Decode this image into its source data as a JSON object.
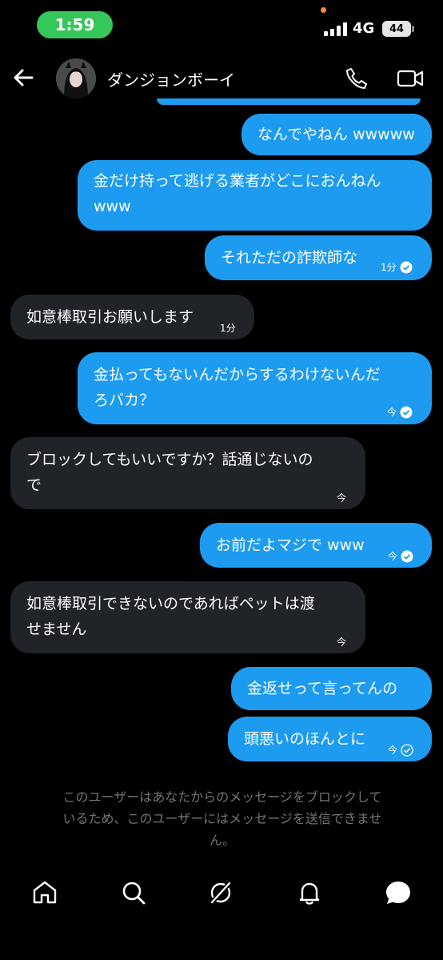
{
  "status_bar": {
    "time": "1:59",
    "network": "4G",
    "battery": "44"
  },
  "header": {
    "contact_name": "ダンジョンボーイ"
  },
  "messages": [
    {
      "dir": "out",
      "text": "なんでやねん wwwww",
      "time": "",
      "read": false
    },
    {
      "dir": "out",
      "text": "金だけ持って逃げる業者がどこにおんねん www",
      "time": "",
      "read": false
    },
    {
      "dir": "out",
      "text": "それただの詐欺師な",
      "time": "1分",
      "read": true
    },
    {
      "dir": "in",
      "text": "如意棒取引お願いします",
      "time": "1分"
    },
    {
      "dir": "out",
      "text": "金払ってもないんだからするわけないんだろバカ？",
      "time": "今",
      "read": true
    },
    {
      "dir": "in",
      "text": "ブロックしてもいいですか？話通じないので",
      "time": "今"
    },
    {
      "dir": "out",
      "text": "お前だよマジで www",
      "time": "今",
      "read": true
    },
    {
      "dir": "in",
      "text": "如意棒取引できないのであればペットは渡せません",
      "time": "今"
    },
    {
      "dir": "out",
      "text": "金返せって言ってんの",
      "time": "",
      "read": false
    },
    {
      "dir": "out",
      "text": "頭悪いのほんとに",
      "time": "今",
      "read": false
    }
  ],
  "message_lines": [
    [
      "なんでやねん wwwww"
    ],
    [
      "金だけ持って逃げる業者がどこにおんねん",
      "www"
    ],
    [
      "それただの詐欺師な"
    ],
    [
      "如意棒取引お願いします"
    ],
    [
      "金払ってもないんだからするわけないんだ",
      "ろバカ？"
    ],
    [
      "ブロックしてもいいですか？話通じないの",
      "で"
    ],
    [
      "お前だよマジで www"
    ],
    [
      "如意棒取引できないのであればペットは渡",
      "せません"
    ],
    [
      "金返せって言ってんの"
    ],
    [
      "頭悪いのほんとに"
    ]
  ],
  "notice": {
    "line1": "このユーザーはあなたからのメッセージをブロックして",
    "line2": "いるため、このユーザーにはメッセージを送信できませ",
    "line3": "ん。"
  },
  "nav": [
    "home-icon",
    "search-icon",
    "grok-icon",
    "notifications-icon",
    "messages-icon"
  ],
  "colors": {
    "outgoing": "#1d9bf0",
    "incoming": "#202327",
    "status_pill": "#35c759",
    "muted": "#71767b"
  }
}
